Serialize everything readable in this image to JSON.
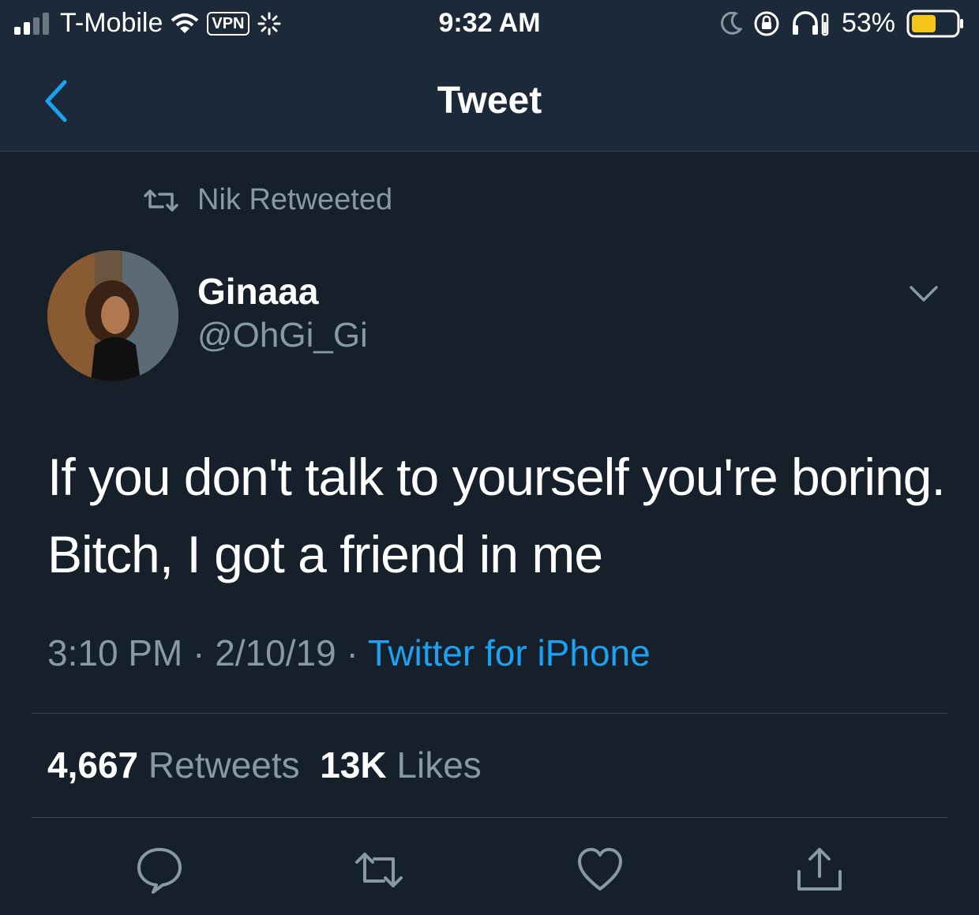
{
  "statusbar": {
    "carrier": "T-Mobile",
    "vpn": "VPN",
    "time": "9:32 AM",
    "battery": "53%",
    "icons": [
      "signal-icon",
      "wifi-icon",
      "vpn-badge",
      "activity-icon",
      "moon-icon",
      "orientation-lock-icon",
      "headphones-icon",
      "battery-icon"
    ]
  },
  "nav": {
    "title": "Tweet",
    "back_icon": "chevron-left-icon"
  },
  "retweet_context": {
    "label": "Nik Retweeted",
    "icon": "retweet-icon"
  },
  "author": {
    "name": "Ginaaa",
    "handle": "@OhGi_Gi"
  },
  "tweet": {
    "line1": "If you don't talk to yourself you're boring.",
    "line2": "Bitch, I got a friend in me"
  },
  "meta": {
    "time": "3:10 PM",
    "date": "2/10/19",
    "sep": " · ",
    "source": "Twitter for iPhone"
  },
  "stats": {
    "retweets_count": "4,667",
    "retweets_label": "Retweets",
    "likes_count": "13K",
    "likes_label": "Likes"
  },
  "actions": [
    "reply-icon",
    "retweet-icon",
    "like-icon",
    "share-icon"
  ],
  "colors": {
    "background": "#15202b",
    "bar": "#1c2938",
    "accent": "#1da1f2",
    "muted": "#8899a6",
    "divider": "#38444d"
  }
}
